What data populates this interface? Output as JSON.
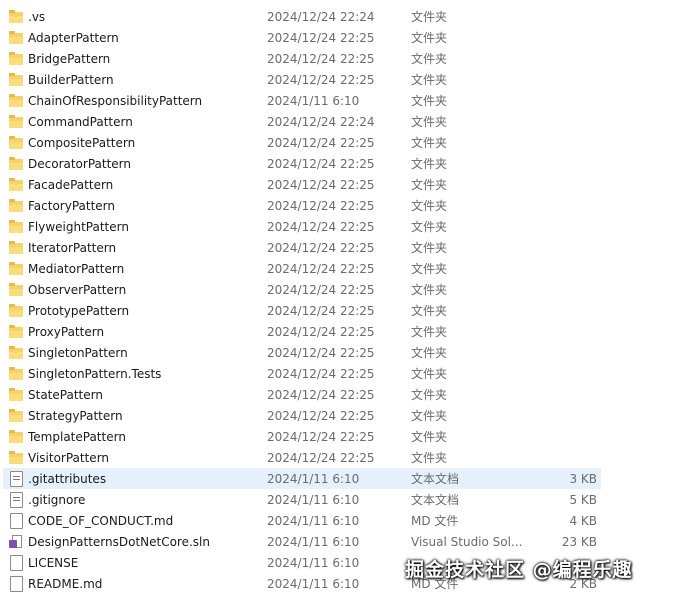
{
  "files": [
    {
      "name": ".vs",
      "date": "2024/12/24 22:24",
      "type": "文件夹",
      "size": "",
      "icon": "folder-icon"
    },
    {
      "name": "AdapterPattern",
      "date": "2024/12/24 22:25",
      "type": "文件夹",
      "size": "",
      "icon": "folder-icon"
    },
    {
      "name": "BridgePattern",
      "date": "2024/12/24 22:25",
      "type": "文件夹",
      "size": "",
      "icon": "folder-icon"
    },
    {
      "name": "BuilderPattern",
      "date": "2024/12/24 22:25",
      "type": "文件夹",
      "size": "",
      "icon": "folder-icon"
    },
    {
      "name": "ChainOfResponsibilityPattern",
      "date": "2024/1/11 6:10",
      "type": "文件夹",
      "size": "",
      "icon": "folder-icon"
    },
    {
      "name": "CommandPattern",
      "date": "2024/12/24 22:24",
      "type": "文件夹",
      "size": "",
      "icon": "folder-icon"
    },
    {
      "name": "CompositePattern",
      "date": "2024/12/24 22:25",
      "type": "文件夹",
      "size": "",
      "icon": "folder-icon"
    },
    {
      "name": "DecoratorPattern",
      "date": "2024/12/24 22:25",
      "type": "文件夹",
      "size": "",
      "icon": "folder-icon"
    },
    {
      "name": "FacadePattern",
      "date": "2024/12/24 22:25",
      "type": "文件夹",
      "size": "",
      "icon": "folder-icon"
    },
    {
      "name": "FactoryPattern",
      "date": "2024/12/24 22:25",
      "type": "文件夹",
      "size": "",
      "icon": "folder-icon"
    },
    {
      "name": "FlyweightPattern",
      "date": "2024/12/24 22:25",
      "type": "文件夹",
      "size": "",
      "icon": "folder-icon"
    },
    {
      "name": "IteratorPattern",
      "date": "2024/12/24 22:25",
      "type": "文件夹",
      "size": "",
      "icon": "folder-icon"
    },
    {
      "name": "MediatorPattern",
      "date": "2024/12/24 22:25",
      "type": "文件夹",
      "size": "",
      "icon": "folder-icon"
    },
    {
      "name": "ObserverPattern",
      "date": "2024/12/24 22:25",
      "type": "文件夹",
      "size": "",
      "icon": "folder-icon"
    },
    {
      "name": "PrototypePattern",
      "date": "2024/12/24 22:25",
      "type": "文件夹",
      "size": "",
      "icon": "folder-icon"
    },
    {
      "name": "ProxyPattern",
      "date": "2024/12/24 22:25",
      "type": "文件夹",
      "size": "",
      "icon": "folder-icon"
    },
    {
      "name": "SingletonPattern",
      "date": "2024/12/24 22:25",
      "type": "文件夹",
      "size": "",
      "icon": "folder-icon"
    },
    {
      "name": "SingletonPattern.Tests",
      "date": "2024/12/24 22:25",
      "type": "文件夹",
      "size": "",
      "icon": "folder-icon"
    },
    {
      "name": "StatePattern",
      "date": "2024/12/24 22:25",
      "type": "文件夹",
      "size": "",
      "icon": "folder-icon"
    },
    {
      "name": "StrategyPattern",
      "date": "2024/12/24 22:25",
      "type": "文件夹",
      "size": "",
      "icon": "folder-icon"
    },
    {
      "name": "TemplatePattern",
      "date": "2024/12/24 22:25",
      "type": "文件夹",
      "size": "",
      "icon": "folder-icon"
    },
    {
      "name": "VisitorPattern",
      "date": "2024/12/24 22:25",
      "type": "文件夹",
      "size": "",
      "icon": "folder-icon"
    },
    {
      "name": ".gitattributes",
      "date": "2024/1/11 6:10",
      "type": "文本文档",
      "size": "3 KB",
      "icon": "text-file-icon",
      "selected": true
    },
    {
      "name": ".gitignore",
      "date": "2024/1/11 6:10",
      "type": "文本文档",
      "size": "5 KB",
      "icon": "text-file-icon"
    },
    {
      "name": "CODE_OF_CONDUCT.md",
      "date": "2024/1/11 6:10",
      "type": "MD 文件",
      "size": "4 KB",
      "icon": "file-icon"
    },
    {
      "name": "DesignPatternsDotNetCore.sln",
      "date": "2024/1/11 6:10",
      "type": "Visual Studio Sol...",
      "size": "23 KB",
      "icon": "visual-studio-solution-icon"
    },
    {
      "name": "LICENSE",
      "date": "2024/1/11 6:10",
      "type": "",
      "size": "",
      "icon": "file-icon"
    },
    {
      "name": "README.md",
      "date": "2024/1/11 6:10",
      "type": "MD 文件",
      "size": "2 KB",
      "icon": "file-icon"
    }
  ],
  "watermark": "掘金技术社区 @编程乐趣"
}
